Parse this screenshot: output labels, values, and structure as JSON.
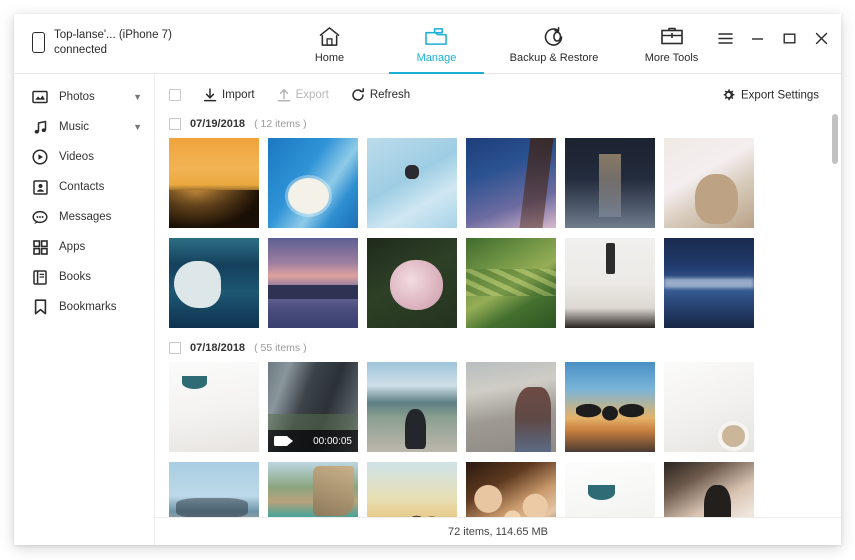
{
  "window": {
    "device_label_line1": "Top-lanse'... (iPhone 7)",
    "device_label_line2": "connected",
    "controls": {
      "menu": "menu-icon",
      "minimize": "minimize-icon",
      "maximize": "maximize-icon",
      "close": "close-icon"
    }
  },
  "nav": {
    "tabs": [
      {
        "label": "Home",
        "icon": "home-icon",
        "active": false
      },
      {
        "label": "Manage",
        "icon": "folder-icon",
        "active": true
      },
      {
        "label": "Backup & Restore",
        "icon": "restore-icon",
        "active": false
      },
      {
        "label": "More Tools",
        "icon": "toolbox-icon",
        "active": false
      }
    ],
    "accent_color": "#1CAFD4"
  },
  "sidebar": {
    "items": [
      {
        "label": "Photos",
        "icon": "photo-icon",
        "expandable": true
      },
      {
        "label": "Music",
        "icon": "music-note-icon",
        "expandable": true
      },
      {
        "label": "Videos",
        "icon": "play-circle-icon",
        "expandable": false
      },
      {
        "label": "Contacts",
        "icon": "contact-card-icon",
        "expandable": false
      },
      {
        "label": "Messages",
        "icon": "message-bubble-icon",
        "expandable": false
      },
      {
        "label": "Apps",
        "icon": "grid-icon",
        "expandable": false
      },
      {
        "label": "Books",
        "icon": "book-icon",
        "expandable": false
      },
      {
        "label": "Bookmarks",
        "icon": "bookmark-icon",
        "expandable": false
      }
    ]
  },
  "toolbar": {
    "select_all_checked": false,
    "import_label": "Import",
    "import_icon": "import-arrow-icon",
    "export_label": "Export",
    "export_icon": "export-arrow-icon",
    "export_disabled": true,
    "refresh_label": "Refresh",
    "refresh_icon": "refresh-icon",
    "export_settings_label": "Export Settings",
    "export_settings_icon": "gear-icon"
  },
  "groups": [
    {
      "date": "07/19/2018",
      "count_label": "( 12 items )",
      "checked": false,
      "thumbnails": [
        {
          "name": "sunset-coastline-photo",
          "art": "a-sunset",
          "type": "photo"
        },
        {
          "name": "pool-sunhat-photo",
          "art": "a-pool",
          "type": "photo"
        },
        {
          "name": "pool-aerial-photo",
          "art": "a-pool2",
          "type": "photo"
        },
        {
          "name": "cherry-blossom-photo",
          "art": "a-blossom",
          "type": "photo"
        },
        {
          "name": "japanese-alley-photo",
          "art": "a-alley",
          "type": "photo"
        },
        {
          "name": "deer-photo",
          "art": "a-deer",
          "type": "photo"
        },
        {
          "name": "beluga-whale-photo",
          "art": "a-beluga",
          "type": "photo"
        },
        {
          "name": "dusk-mountain-sea-photo",
          "art": "a-dusk",
          "type": "photo"
        },
        {
          "name": "hydrangea-flower-photo",
          "art": "a-flower",
          "type": "photo"
        },
        {
          "name": "rice-terrace-photo",
          "art": "a-terrace",
          "type": "photo"
        },
        {
          "name": "washing-hands-photo",
          "art": "a-wash",
          "type": "photo"
        },
        {
          "name": "ocean-waves-photo",
          "art": "a-ocean",
          "type": "photo"
        }
      ]
    },
    {
      "date": "07/18/2018",
      "count_label": "( 55 items )",
      "checked": false,
      "thumbnails": [
        {
          "name": "living-room-photo",
          "art": "a-room",
          "type": "photo"
        },
        {
          "name": "city-building-video",
          "art": "a-video",
          "type": "video",
          "duration": "00:00:05"
        },
        {
          "name": "person-by-sea-photo",
          "art": "a-seaperson",
          "type": "photo"
        },
        {
          "name": "plaza-woman-photo",
          "art": "a-plaza",
          "type": "photo"
        },
        {
          "name": "jumping-silhouettes-photo",
          "art": "a-jump",
          "type": "photo"
        },
        {
          "name": "white-tshirt-flatlay-photo",
          "art": "a-shirt",
          "type": "photo"
        },
        {
          "name": "beach-boats-photo",
          "art": "a-beach",
          "type": "photo"
        },
        {
          "name": "limestone-cliff-photo",
          "art": "a-cliff",
          "type": "photo"
        },
        {
          "name": "golden-beach-photo",
          "art": "a-goldbeach",
          "type": "photo"
        },
        {
          "name": "family-portrait-photo",
          "art": "a-family",
          "type": "photo"
        },
        {
          "name": "pendant-lamp-photo",
          "art": "a-lamp",
          "type": "photo"
        },
        {
          "name": "cat-photo",
          "art": "a-cat",
          "type": "photo"
        }
      ]
    }
  ],
  "statusbar": {
    "summary": "72 items, 114.65 MB"
  }
}
